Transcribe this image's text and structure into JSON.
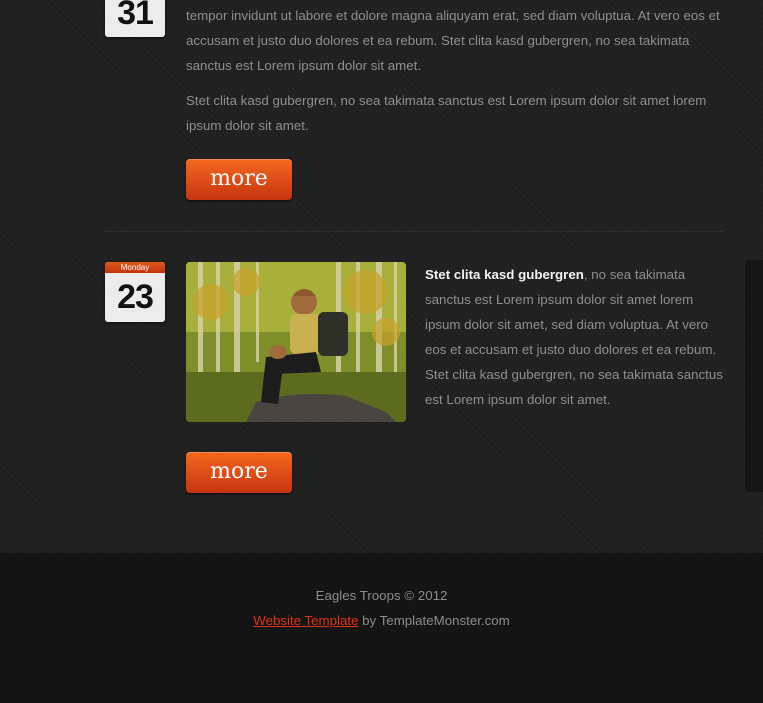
{
  "posts": [
    {
      "day_number": "31",
      "paragraphs": [
        "tempor invidunt ut labore et dolore magna aliquyam erat, sed diam voluptua. At vero eos et accusam et justo duo dolores et ea rebum. Stet clita kasd gubergren, no sea takimata sanctus est Lorem ipsum dolor sit amet.",
        "Stet clita kasd gubergren, no sea takimata sanctus est Lorem ipsum dolor sit amet lorem ipsum dolor sit amet."
      ],
      "more_label": "more"
    },
    {
      "day_label": "Monday",
      "day_number": "23",
      "lead": "Stet clita kasd gubergren",
      "text": ", no sea takimata sanctus est Lorem ipsum dolor sit amet lorem ipsum dolor sit amet, sed diam voluptua. At vero eos et accusam et justo duo dolores et ea rebum. Stet clita kasd gubergren, no sea takimata sanctus est Lorem ipsum dolor sit amet.",
      "more_label": "more"
    }
  ],
  "footer": {
    "copyright": "Eagles Troops © 2012",
    "link_text": "Website Template",
    "by_text": " by TemplateMonster.com"
  },
  "colors": {
    "accent": "#e2501a",
    "link": "#e1321b",
    "background": "#202020",
    "footer_bg": "#141414"
  }
}
